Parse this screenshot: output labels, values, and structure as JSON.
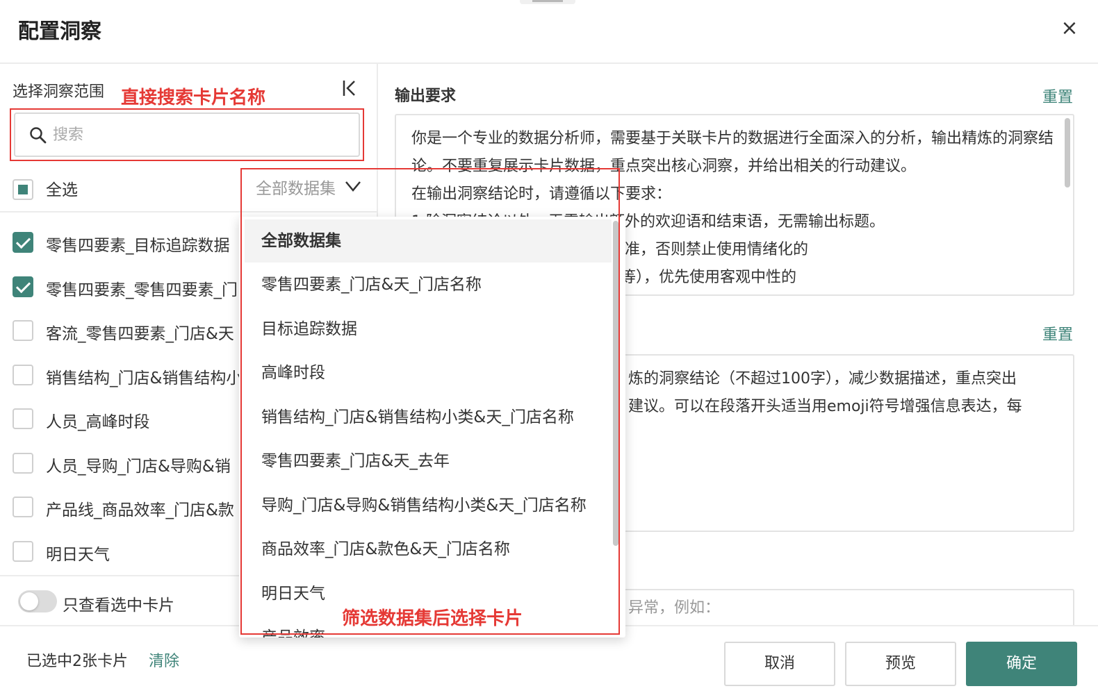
{
  "dialog": {
    "title": "配置洞察",
    "close_icon": "×"
  },
  "left": {
    "scope_label": "选择洞察范围",
    "search_placeholder": "搜索",
    "select_all_label": "全选",
    "dataset_filter_value": "全部数据集",
    "cards": [
      {
        "label": "零售四要素_目标追踪数据",
        "checked": true
      },
      {
        "label": "零售四要素_零售四要素_门",
        "checked": true
      },
      {
        "label": "客流_零售四要素_门店&天",
        "checked": false
      },
      {
        "label": "销售结构_门店&销售结构小",
        "checked": false
      },
      {
        "label": "人员_高峰时段",
        "checked": false
      },
      {
        "label": "人员_导购_门店&导购&销",
        "checked": false
      },
      {
        "label": "产品线_商品效率_门店&款",
        "checked": false
      },
      {
        "label": "明日天气",
        "checked": false
      }
    ],
    "toggle_label": "只查看选中卡片"
  },
  "annotations": {
    "search_hint": "直接搜索卡片名称",
    "filter_hint": "筛选数据集后选择卡片"
  },
  "right": {
    "output_title": "输出要求",
    "reset_label": "重置",
    "output_text": "你是一个专业的数据分析师，需要基于关联卡片的数据进行全面深入的分析，输出精炼的洞察结论。不要重复展示卡片数据，重点突出核心洞察，并给出相关的行动建议。\n在输出洞察结论时，请遵循以下要求：\n1.除洞察结论以外，无需输出额外的欢迎语和结束语，无需输出标题。\n2.除非有充分的数据和明确的标准，否则禁止使用情绪化的\n致命/根本/彻底/完全/堪忧/巨大等），优先使用客观中性的",
    "summary_text": "炼的洞察结论（不超过100字），减少数据描述，重点突出\n建议。可以在段落开头适当用emoji符号增强信息表达，每",
    "example_placeholder": "异常，例如："
  },
  "dropdown": {
    "options": [
      "全部数据集",
      "零售四要素_门店&天_门店名称",
      "目标追踪数据",
      "高峰时段",
      "销售结构_门店&销售结构小类&天_门店名称",
      "零售四要素_门店&天_去年",
      "导购_门店&导购&销售结构小类&天_门店名称",
      "商品效率_门店&款色&天_门店名称",
      "明日天气",
      "产品效率"
    ],
    "active_index": 0
  },
  "footer": {
    "selected_text": "已选中2张卡片",
    "clear_label": "清除",
    "cancel_label": "取消",
    "preview_label": "预览",
    "confirm_label": "确定"
  },
  "colors": {
    "accent": "#3f8479",
    "annotation_red": "#e53935"
  }
}
